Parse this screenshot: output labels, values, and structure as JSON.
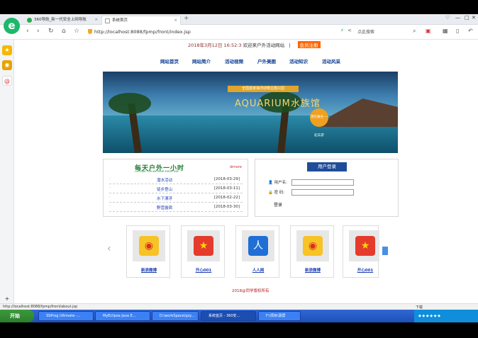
{
  "browser": {
    "tabs": [
      {
        "label": "360导航_新一代安全上网导航"
      },
      {
        "label": "系统首页"
      }
    ],
    "new_tab": "+",
    "address": "http://localhost:8088/fpmp/front/index.jsp",
    "search_placeholder": "点此搜索",
    "status_url": "http://localhost:8088/fpmp/front/about.jsp",
    "status_right": "下载"
  },
  "page": {
    "date_time": "2018年3月12日  16:52:3",
    "welcome": "欢迎来户外活动网站",
    "separator": "|",
    "register": "会员注册",
    "menu": [
      "网站首页",
      "网站简介",
      "活动视频",
      "户外美图",
      "活动知识",
      "活动风采"
    ],
    "banner": {
      "tag": "全国首家海洋动物主题公园",
      "title": "AQUARIUM水族馆",
      "circle": "现在报名·一起去游"
    },
    "news": {
      "title": "每天户外一小时",
      "subtitle": "OUTSIDE FOR AN HOUR EVERY DAY",
      "more": "more",
      "items": [
        {
          "title": "潜水活动",
          "date": "[2018-03-29]"
        },
        {
          "title": "徒步登山",
          "date": "[2018-03-11]"
        },
        {
          "title": "水下漂浮",
          "date": "[2018-02-22]"
        },
        {
          "title": "野营露宿",
          "date": "[2018-03-30]"
        }
      ]
    },
    "login": {
      "title": "用户登录",
      "username_label": "用户名:",
      "password_label": "密  码:",
      "submit": "登录"
    },
    "links": [
      {
        "label": "新浪微博",
        "icon": "weibo-icon",
        "color": "#f7c325"
      },
      {
        "label": "开心001",
        "icon": "kaixin-icon",
        "color": "#e53b2c"
      },
      {
        "label": "人人网",
        "icon": "renren-icon",
        "color": "#1f6fd6"
      },
      {
        "label": "新浪微博",
        "icon": "weibo-icon",
        "color": "#f7c325"
      },
      {
        "label": "开心001",
        "icon": "kaixin-icon",
        "color": "#e53b2c"
      }
    ],
    "copyright": "2018@同学版权所有"
  },
  "taskbar": {
    "start": "开始",
    "items": [
      "SSProg Ultimate -...",
      "MyEclipse Java E...",
      "D:\\workSpace\\qzy...",
      "系统首页 - 360安...",
      "F:\\项目\\录屏"
    ]
  }
}
